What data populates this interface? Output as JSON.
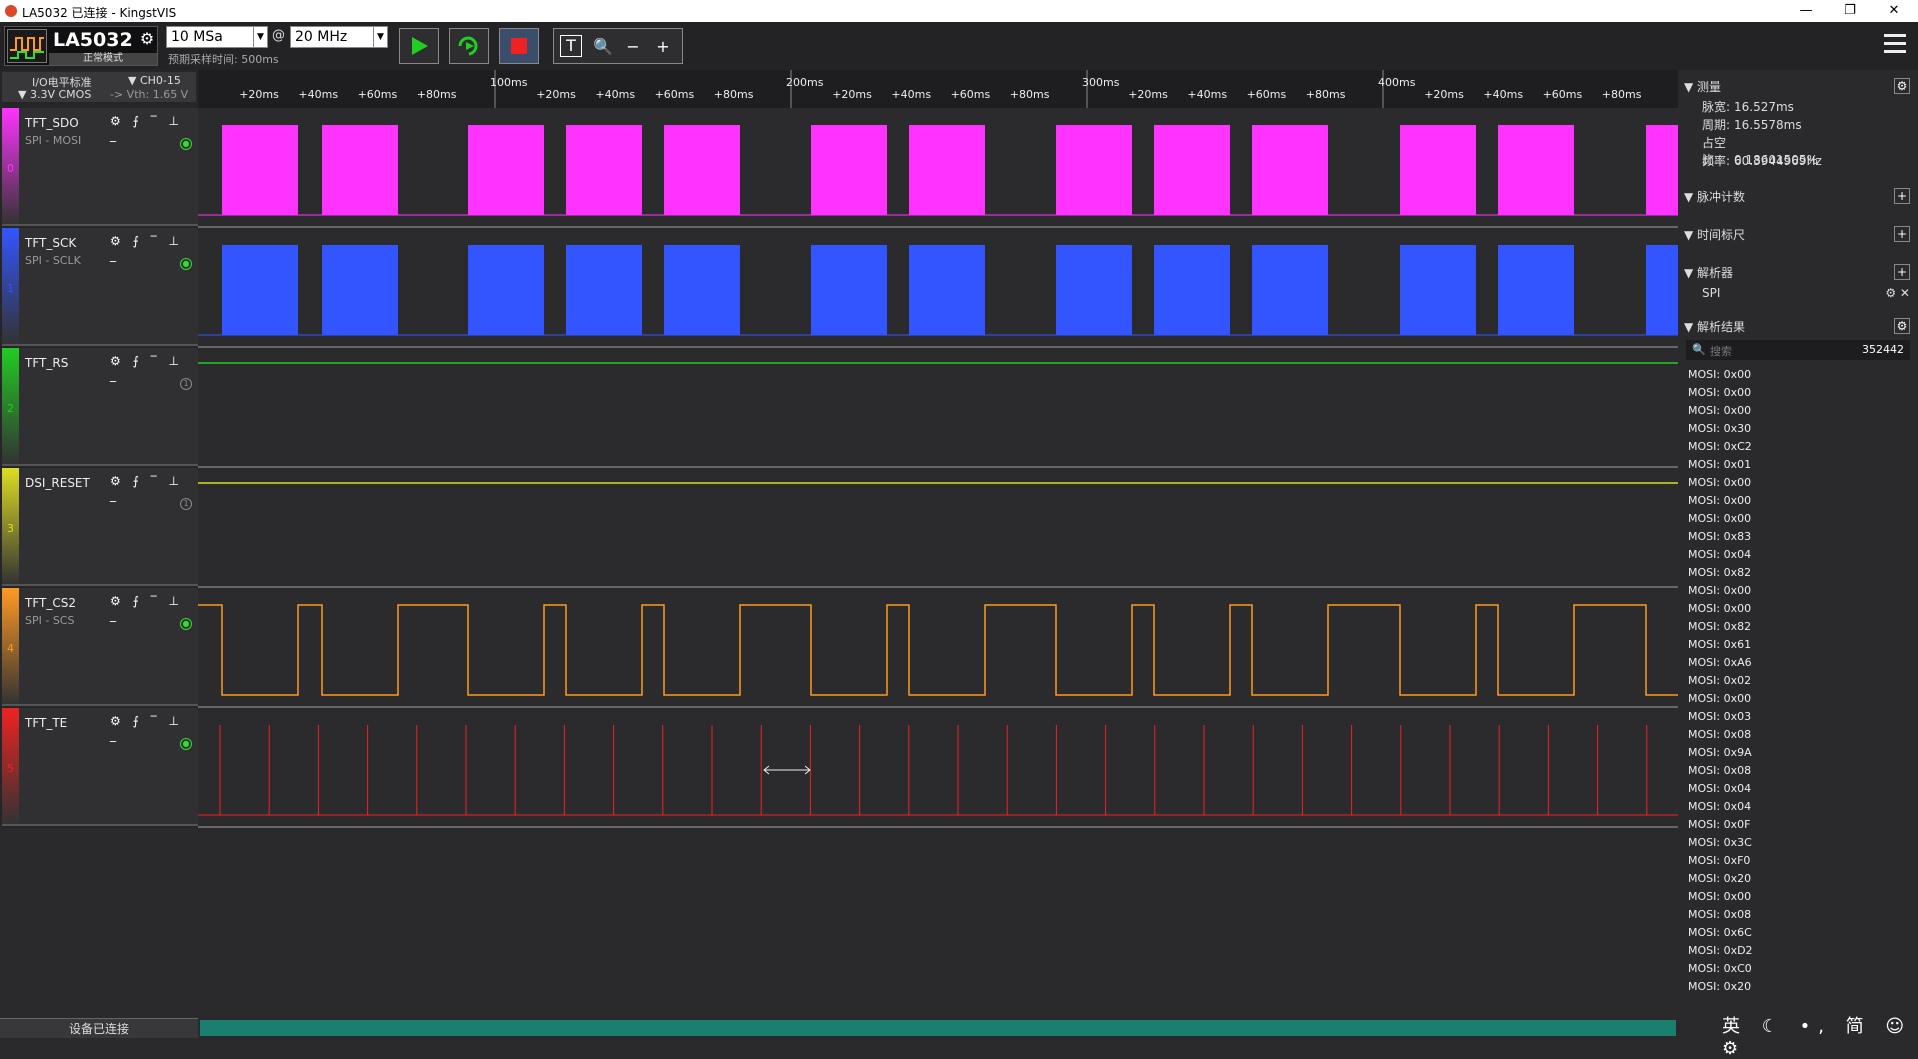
{
  "window": {
    "title": "LA5032 已连接 - KingstVIS",
    "min": "—",
    "max": "❐",
    "close": "✕"
  },
  "toolbar": {
    "device_name": "LA5032",
    "device_mode": "正常模式",
    "sample_depth": "10 MSa",
    "at": "@",
    "sample_rate": "20 MHz",
    "est_time": "预期采样时间: 500ms",
    "zoom_icons": [
      "T",
      "🔍",
      "−",
      "+"
    ]
  },
  "io": {
    "standard": "I/O电平标准",
    "channels": "CH0-15",
    "level": "3.3V CMOS",
    "vth": "-> Vth: 1.65 V"
  },
  "channels": [
    {
      "num": "0",
      "name": "TFT_SDO",
      "decoder": "SPI - MOSI",
      "color": "#ff33ff",
      "led": "●",
      "led_color": "#33dd33"
    },
    {
      "num": "1",
      "name": "TFT_SCK",
      "decoder": "SPI - SCLK",
      "color": "#3355ff",
      "led": "●",
      "led_color": "#33dd33"
    },
    {
      "num": "2",
      "name": "TFT_RS",
      "decoder": "",
      "color": "#22cc22",
      "led": "1",
      "led_color": "#888"
    },
    {
      "num": "3",
      "name": "DSI_RESET",
      "decoder": "",
      "color": "#dddd22",
      "led": "1",
      "led_color": "#888"
    },
    {
      "num": "4",
      "name": "TFT_CS2",
      "decoder": "SPI - SCS",
      "color": "#ff9922",
      "led": "●",
      "led_color": "#33dd33"
    },
    {
      "num": "5",
      "name": "TFT_TE",
      "decoder": "",
      "color": "#ee2222",
      "led": "●",
      "led_color": "#33dd33"
    }
  ],
  "ruler": {
    "major": [
      "100ms",
      "200ms",
      "300ms",
      "400ms"
    ],
    "minor": [
      "+20ms",
      "+40ms",
      "+60ms",
      "+80ms"
    ]
  },
  "status": "设备已连接",
  "panel": {
    "measure_title": "测量",
    "measure": [
      {
        "k": "脉宽:",
        "v": "16.527ms"
      },
      {
        "k": "周期:",
        "v": "16.5578ms"
      },
      {
        "k": "占空比:",
        "v": "0.18601505%"
      },
      {
        "k": "频率:",
        "v": "60.3944969Hz"
      }
    ],
    "pulse_count": "脉冲计数",
    "time_ruler": "时间标尺",
    "analyzer": "解析器",
    "analyzer_item": "SPI",
    "results_title": "解析结果",
    "search_placeholder": "搜索",
    "result_count": "352442",
    "results": [
      "MOSI: 0x00",
      "MOSI: 0x00",
      "MOSI: 0x00",
      "MOSI: 0x30",
      "MOSI: 0xC2",
      "MOSI: 0x01",
      "MOSI: 0x00",
      "MOSI: 0x00",
      "MOSI: 0x00",
      "MOSI: 0x83",
      "MOSI: 0x04",
      "MOSI: 0x82",
      "MOSI: 0x00",
      "MOSI: 0x00",
      "MOSI: 0x82",
      "MOSI: 0x61",
      "MOSI: 0xA6",
      "MOSI: 0x02",
      "MOSI: 0x00",
      "MOSI: 0x03",
      "MOSI: 0x08",
      "MOSI: 0x9A",
      "MOSI: 0x08",
      "MOSI: 0x04",
      "MOSI: 0x04",
      "MOSI: 0x0F",
      "MOSI: 0x3C",
      "MOSI: 0xF0",
      "MOSI: 0x20",
      "MOSI: 0x00",
      "MOSI: 0x08",
      "MOSI: 0x6C",
      "MOSI: 0xD2",
      "MOSI: 0xC0",
      "MOSI: 0x20"
    ],
    "ime": "英 ☾ •, 简 ☺ ⚙"
  }
}
